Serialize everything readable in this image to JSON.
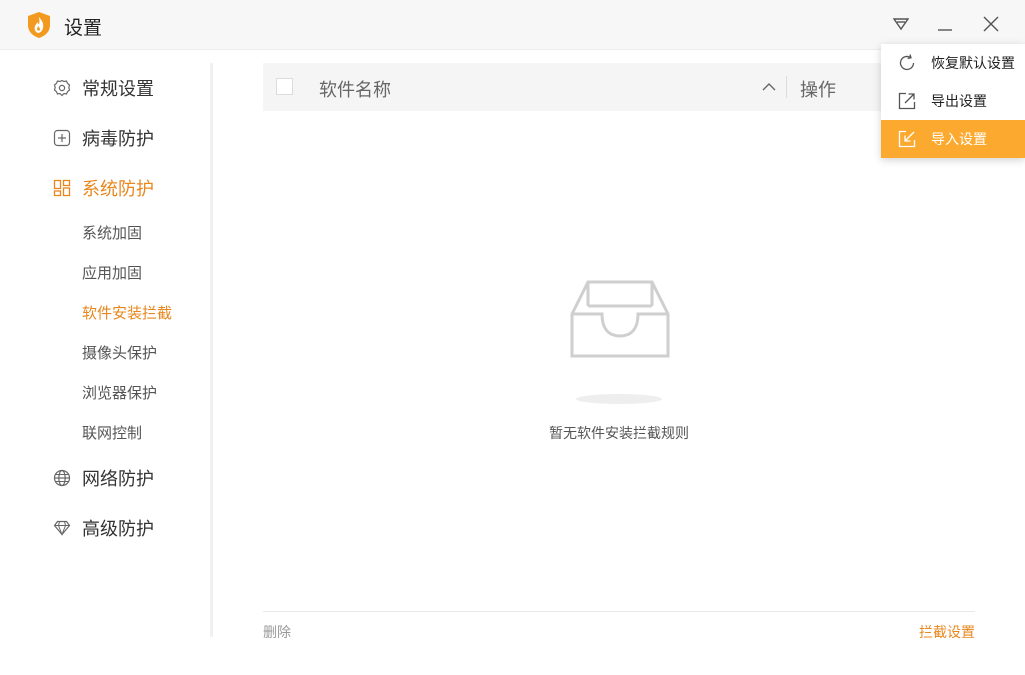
{
  "window": {
    "title": "设置"
  },
  "title_bar": {
    "menu_icon": "dropdown-triangle-icon",
    "minimize_icon": "minimize-icon",
    "close_icon": "close-icon"
  },
  "sidebar": {
    "items": [
      {
        "label": "常规设置",
        "icon": "gear-icon",
        "active": false
      },
      {
        "label": "病毒防护",
        "icon": "plus-box-icon",
        "active": false
      },
      {
        "label": "系统防护",
        "icon": "grid-icon",
        "active": true
      },
      {
        "label": "网络防护",
        "icon": "globe-icon",
        "active": false
      },
      {
        "label": "高级防护",
        "icon": "diamond-icon",
        "active": false
      }
    ],
    "sub_items": [
      {
        "label": "系统加固",
        "active": false
      },
      {
        "label": "应用加固",
        "active": false
      },
      {
        "label": "软件安装拦截",
        "active": true
      },
      {
        "label": "摄像头保护",
        "active": false
      },
      {
        "label": "浏览器保护",
        "active": false
      },
      {
        "label": "联网控制",
        "active": false
      }
    ]
  },
  "table": {
    "col_name": "软件名称",
    "col_op": "操作",
    "select_all_checked": false
  },
  "empty_state": {
    "icon": "empty-inbox-icon",
    "message": "暂无软件安装拦截规则"
  },
  "footer": {
    "delete_label": "删除",
    "block_settings_label": "拦截设置"
  },
  "dropdown": {
    "items": [
      {
        "label": "恢复默认设置",
        "icon": "restore-icon",
        "highlighted": false
      },
      {
        "label": "导出设置",
        "icon": "export-icon",
        "highlighted": false
      },
      {
        "label": "导入设置",
        "icon": "import-icon",
        "highlighted": true
      }
    ]
  },
  "colors": {
    "accent": "#e8871e",
    "menu_highlight": "#fca92f"
  }
}
